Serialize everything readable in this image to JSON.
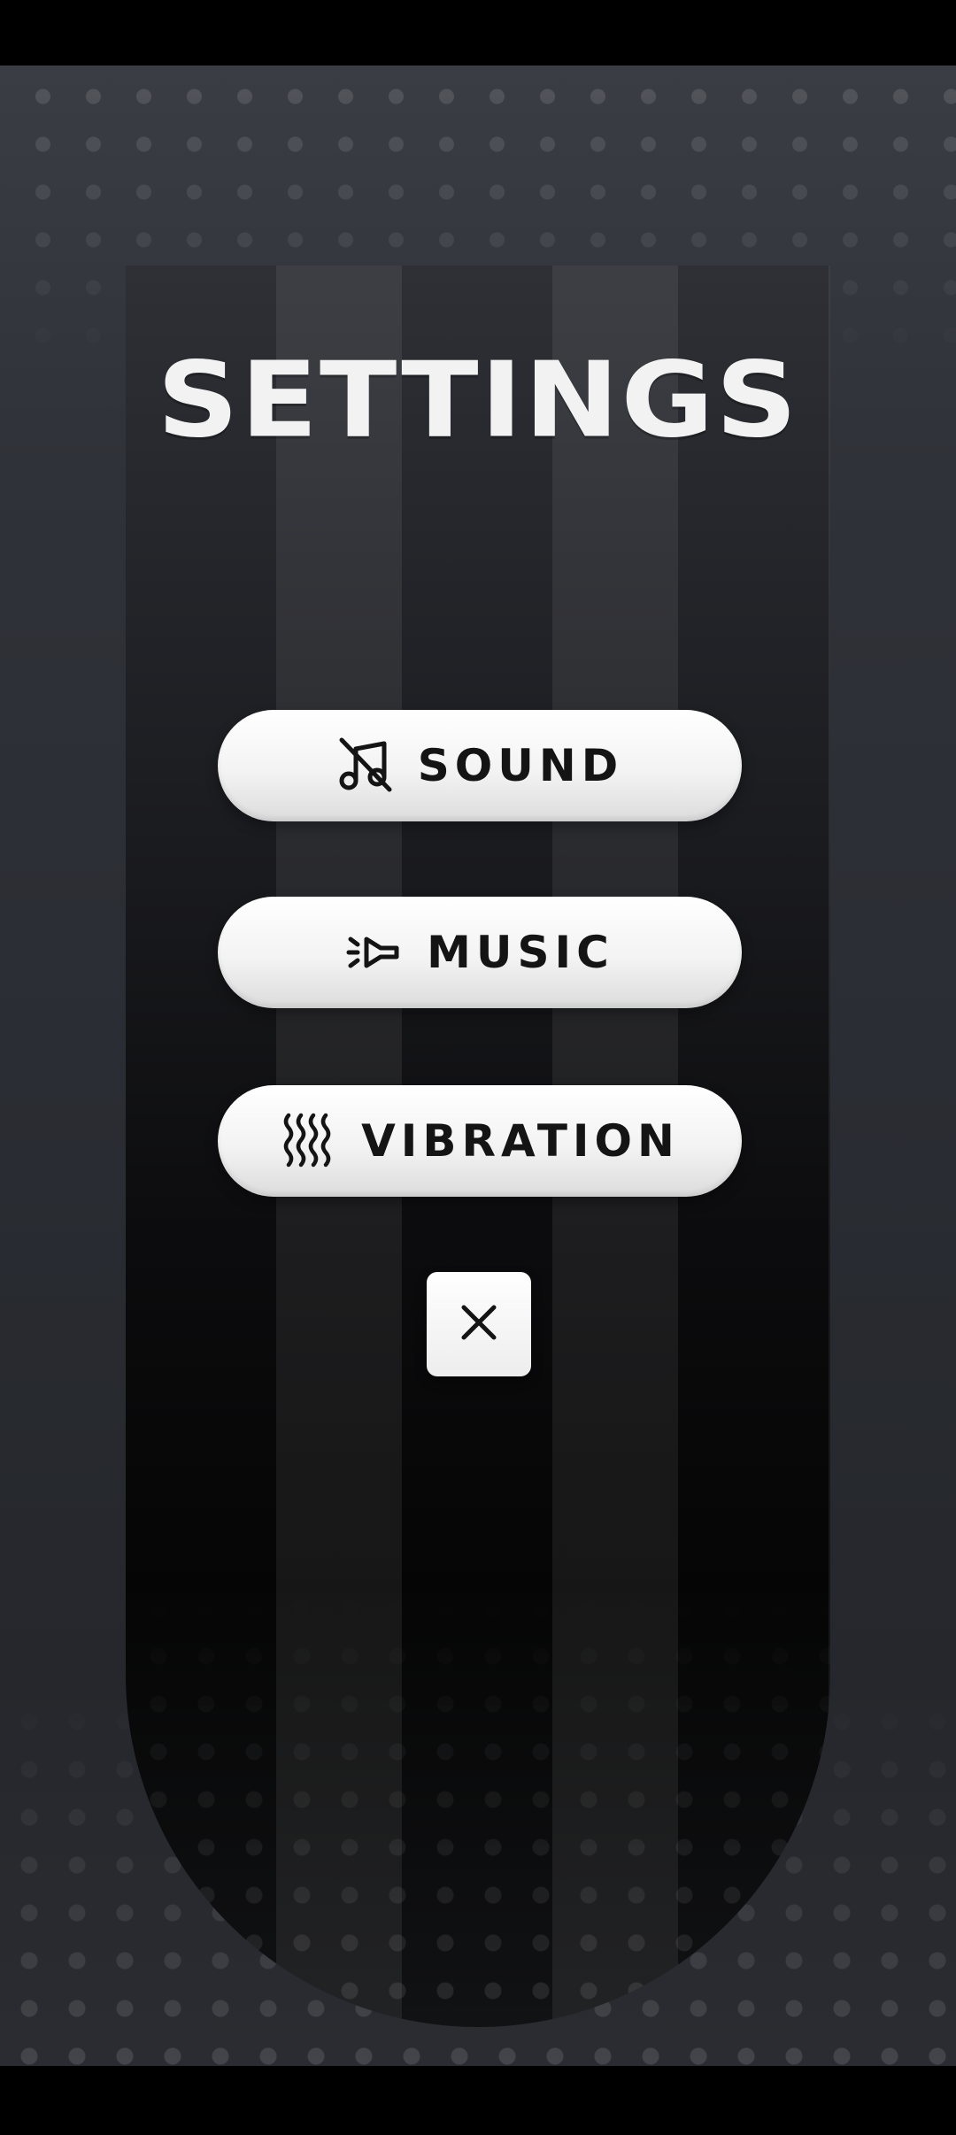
{
  "title": "SETTINGS",
  "buttons": {
    "sound": {
      "label": "SOUND",
      "icon": "music-note-off-icon"
    },
    "music": {
      "label": "MUSIC",
      "icon": "speaker-cone-icon"
    },
    "vibration": {
      "label": "VIBRATION",
      "icon": "vibration-waves-icon"
    }
  },
  "close": {
    "icon": "close-icon"
  },
  "colors": {
    "button_bg": "#ffffff",
    "button_text": "#141414",
    "title_text": "#f2f2f2",
    "background": "#2a2d33"
  }
}
